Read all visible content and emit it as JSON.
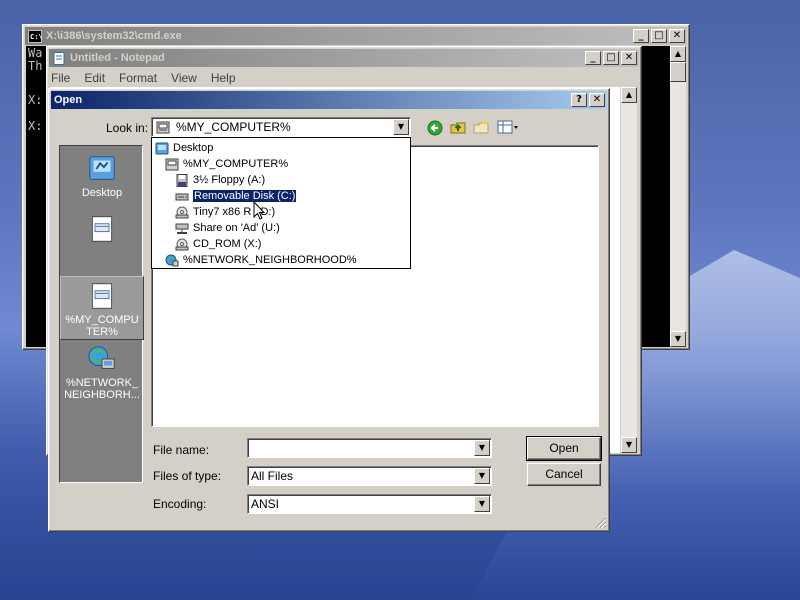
{
  "cmd_window": {
    "title": "X:\\i386\\system32\\cmd.exe",
    "lines": [
      "Wa",
      "Th",
      "",
      "X:",
      "",
      "X:"
    ]
  },
  "notepad_window": {
    "title": "Untitled - Notepad",
    "menu": [
      "File",
      "Edit",
      "Format",
      "View",
      "Help"
    ]
  },
  "open_dialog": {
    "title": "Open",
    "look_in_label": "Look in:",
    "look_in_value": "%MY_COMPUTER%",
    "places": [
      {
        "label": "Desktop",
        "icon": "desktop-icon"
      },
      {
        "label": "",
        "icon": "document-icon"
      },
      {
        "label": "%MY_COMPUTER%",
        "icon": "computer-icon"
      },
      {
        "label": "%NETWORK_NEIGHBORH...",
        "icon": "network-icon"
      }
    ],
    "dropdown_items": [
      {
        "label": "Desktop",
        "icon": "desktop-icon"
      },
      {
        "label": "%MY_COMPUTER%",
        "icon": "computer-icon"
      },
      {
        "label": "3½ Floppy (A:)",
        "icon": "floppy-icon"
      },
      {
        "label": "Removable Disk (C:)",
        "icon": "removable-disk-icon",
        "selected": true
      },
      {
        "label": "Tiny7 x86 R   D:)",
        "icon": "cd-drive-icon"
      },
      {
        "label": "Share on 'Ad' (U:)",
        "icon": "network-drive-icon"
      },
      {
        "label": "CD_ROM (X:)",
        "icon": "cd-drive-icon"
      },
      {
        "label": "%NETWORK_NEIGHBORHOOD%",
        "icon": "network-icon"
      }
    ],
    "file_name_label": "File name:",
    "file_name_value": "",
    "files_of_type_label": "Files of type:",
    "files_of_type_value": "All Files",
    "encoding_label": "Encoding:",
    "encoding_value": "ANSI",
    "open_button": "Open",
    "cancel_button": "Cancel",
    "toolbar_icons": [
      "back-icon",
      "up-folder-icon",
      "new-folder-icon",
      "view-menu-icon"
    ]
  },
  "colors": {
    "title_active": "#0a246a",
    "title_gradient_end": "#a6caf0",
    "face": "#d4d0c8",
    "selection": "#0a246a",
    "desktop": "#5d77be"
  }
}
